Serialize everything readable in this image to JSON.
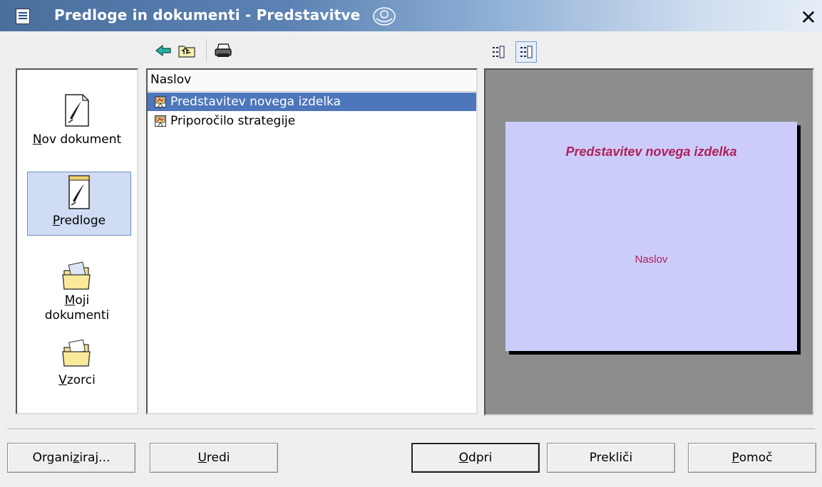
{
  "window": {
    "title": "Predloge in dokumenti - Predstavitve",
    "close_glyph": "✕"
  },
  "toolbar": {
    "icons": [
      "back-arrow-icon",
      "folder-up-icon",
      "printer-icon"
    ],
    "view_buttons": [
      "details-view-icon",
      "preview-view-icon"
    ]
  },
  "sidebar": {
    "items": [
      {
        "label_ul": "N",
        "label_rest": "ov dokument",
        "icon": "new-document-icon"
      },
      {
        "label_ul": "P",
        "label_rest": "redloge",
        "icon": "templates-icon",
        "selected": true
      },
      {
        "label_ul": "M",
        "label_rest": "oji",
        "label_line2": "dokumenti",
        "icon": "my-documents-folder-icon"
      },
      {
        "label_ul": "V",
        "label_rest": "zorci",
        "icon": "samples-folder-icon"
      }
    ]
  },
  "list": {
    "header": "Naslov",
    "rows": [
      {
        "label": "Predstavitev novega izdelka",
        "selected": true,
        "icon": "presentation-icon"
      },
      {
        "label": "Priporočilo strategije",
        "selected": false,
        "icon": "presentation-icon"
      }
    ]
  },
  "preview": {
    "slide_title": "Predstavitev novega izdelka",
    "slide_subtitle": "Naslov",
    "colors": {
      "slide_bg": "#ccccfa",
      "text": "#b0205b",
      "panel_bg": "#8d8d8d"
    }
  },
  "buttons": {
    "organize": {
      "pre": "Organi",
      "ul": "z",
      "post": "iraj..."
    },
    "edit": {
      "pre": "",
      "ul": "U",
      "post": "redi"
    },
    "open": {
      "pre": "",
      "ul": "O",
      "post": "dpri"
    },
    "cancel": {
      "pre": "Prekliči",
      "ul": "",
      "post": ""
    },
    "help": {
      "pre": "",
      "ul": "P",
      "post": "omoč"
    }
  },
  "colors": {
    "selection": "#4d76bb",
    "titlebar": "#5b82b3"
  }
}
